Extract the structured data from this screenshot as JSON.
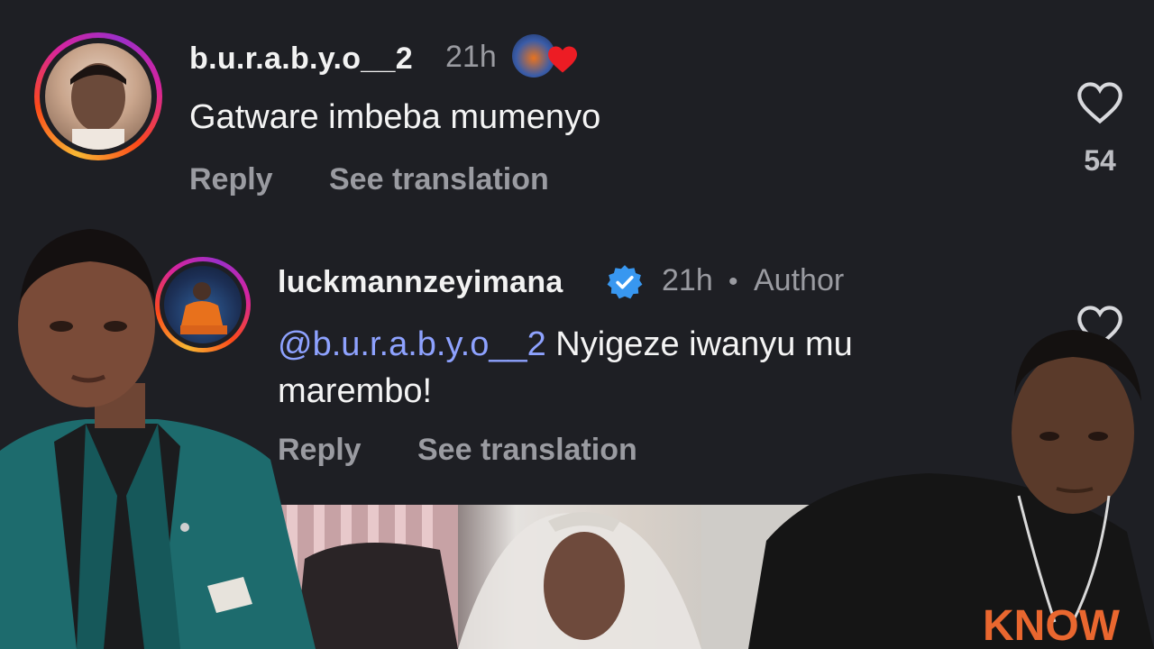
{
  "comments": [
    {
      "username": "b.u.r.a.b.y.o__2",
      "time": "21h",
      "text": "Gatware imbeba mumenyo",
      "reply_label": "Reply",
      "translate_label": "See translation",
      "likes": "54"
    },
    {
      "username": "luckmannzeyimana",
      "time": "21h",
      "separator": "•",
      "author_badge": "Author",
      "mention": "@b.u.r.a.b.y.o__2",
      "text_line1": " Nyigeze iwanyu mu",
      "text_line2": "marembo!",
      "reply_label": "Reply",
      "translate_label": "See translation"
    }
  ],
  "icons": {
    "like": "heart-outline-icon",
    "verified": "verified-badge-icon",
    "reaction": "heart-filled-icon"
  },
  "colors": {
    "background": "#1e1f24",
    "mention": "#8ea2ff",
    "verified": "#3897f0",
    "heart": "#ed1c24"
  }
}
